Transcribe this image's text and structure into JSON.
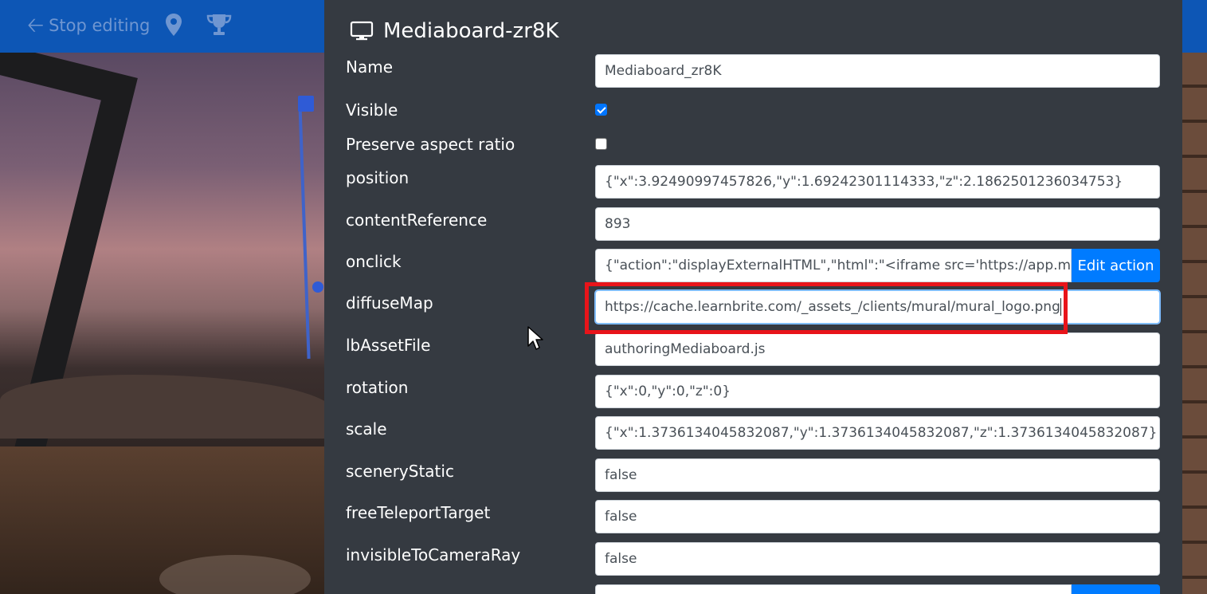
{
  "toolbar": {
    "stop_label": "Stop editing",
    "stop_icon": "arrow-left-icon",
    "location_icon": "map-pin-icon",
    "trophy_icon": "trophy-icon",
    "background": "#0d56b5"
  },
  "panel": {
    "title": "Mediaboard-zr8K",
    "title_icon": "monitor-icon",
    "fields": {
      "name": {
        "label": "Name",
        "value": "Mediaboard_zr8K"
      },
      "visible": {
        "label": "Visible",
        "checked": true
      },
      "preserve_aspect": {
        "label": "Preserve aspect ratio",
        "checked": false
      },
      "position": {
        "label": "position",
        "value": "{\"x\":3.92490997457826,\"y\":1.69242301114333,\"z\":2.1862501236034753}"
      },
      "content_reference": {
        "label": "contentReference",
        "value": "893"
      },
      "onclick": {
        "label": "onclick",
        "value": "{\"action\":\"displayExternalHTML\",\"html\":\"<iframe src='https://app.mur",
        "button": "Edit action"
      },
      "diffuse_map": {
        "label": "diffuseMap",
        "value": "https://cache.learnbrite.com/_assets_/clients/mural/mural_logo.png"
      },
      "lb_asset_file": {
        "label": "lbAssetFile",
        "value": "authoringMediaboard.js"
      },
      "rotation": {
        "label": "rotation",
        "value": "{\"x\":0,\"y\":0,\"z\":0}"
      },
      "scale": {
        "label": "scale",
        "value": "{\"x\":1.3736134045832087,\"y\":1.3736134045832087,\"z\":1.3736134045832087}"
      },
      "scenery_static": {
        "label": "sceneryStatic",
        "value": "false"
      },
      "free_teleport_target": {
        "label": "freeTeleportTarget",
        "value": "false"
      },
      "invisible_to_camera_ray": {
        "label": "invisibleToCameraRay",
        "value": "false"
      }
    }
  },
  "colors": {
    "panel_bg": "#353a41",
    "button_primary": "#007bff",
    "highlight": "#e8141a"
  }
}
